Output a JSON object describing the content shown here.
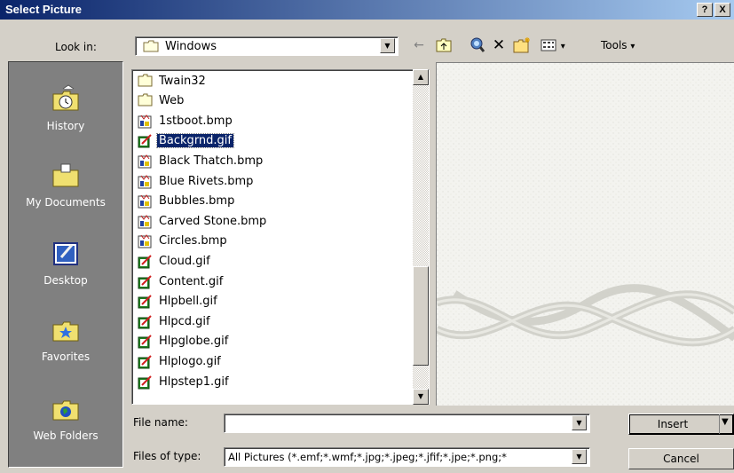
{
  "window": {
    "title": "Select Picture",
    "help_label": "?",
    "close_label": "X"
  },
  "toolbar": {
    "look_in_label": "Look in:",
    "look_in_value": "Windows",
    "tools_label": "Tools",
    "back_glyph": "←",
    "delete_glyph": "✕",
    "dropdown_glyph": "▾"
  },
  "places": [
    {
      "label": "History",
      "icon": "history-icon"
    },
    {
      "label": "My Documents",
      "icon": "my-documents-icon"
    },
    {
      "label": "Desktop",
      "icon": "desktop-icon"
    },
    {
      "label": "Favorites",
      "icon": "favorites-icon"
    },
    {
      "label": "Web Folders",
      "icon": "web-folders-icon"
    }
  ],
  "files": [
    {
      "name": "Twain32",
      "type": "folder"
    },
    {
      "name": "Web",
      "type": "folder"
    },
    {
      "name": "1stboot.bmp",
      "type": "bmp"
    },
    {
      "name": "Backgrnd.gif",
      "type": "gif",
      "selected": true
    },
    {
      "name": "Black Thatch.bmp",
      "type": "bmp"
    },
    {
      "name": "Blue Rivets.bmp",
      "type": "bmp"
    },
    {
      "name": "Bubbles.bmp",
      "type": "bmp"
    },
    {
      "name": "Carved Stone.bmp",
      "type": "bmp"
    },
    {
      "name": "Circles.bmp",
      "type": "bmp"
    },
    {
      "name": "Cloud.gif",
      "type": "gif"
    },
    {
      "name": "Content.gif",
      "type": "gif"
    },
    {
      "name": "Hlpbell.gif",
      "type": "gif"
    },
    {
      "name": "Hlpcd.gif",
      "type": "gif"
    },
    {
      "name": "Hlpglobe.gif",
      "type": "gif"
    },
    {
      "name": "Hlplogo.gif",
      "type": "gif"
    },
    {
      "name": "Hlpstep1.gif",
      "type": "gif"
    }
  ],
  "footer": {
    "file_name_label": "File name:",
    "file_name_value": "",
    "file_type_label": "Files of type:",
    "file_type_value": "All Pictures (*.emf;*.wmf;*.jpg;*.jpeg;*.jfif;*.jpe;*.png;*",
    "insert_label": "Insert",
    "cancel_label": "Cancel"
  },
  "colors": {
    "title_start": "#0a246a",
    "title_end": "#a6caf0",
    "selection": "#0a246a",
    "face": "#d4d0c8",
    "places_bg": "#808080"
  }
}
